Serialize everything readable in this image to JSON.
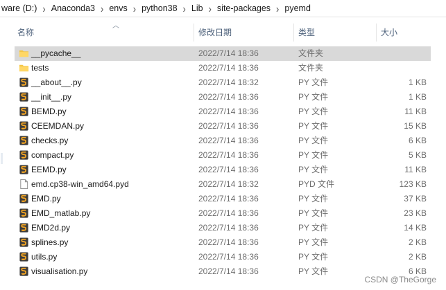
{
  "breadcrumb": [
    "ware (D:)",
    "Anaconda3",
    "envs",
    "python38",
    "Lib",
    "site-packages",
    "pyemd"
  ],
  "columns": {
    "name": "名称",
    "date": "修改日期",
    "type": "类型",
    "size": "大小"
  },
  "files": [
    {
      "name": "__pycache__",
      "date": "2022/7/14 18:36",
      "type": "文件夹",
      "size": "",
      "icon": "folder-icon",
      "selected": true
    },
    {
      "name": "tests",
      "date": "2022/7/14 18:36",
      "type": "文件夹",
      "size": "",
      "icon": "folder-icon"
    },
    {
      "name": "__about__.py",
      "date": "2022/7/14 18:32",
      "type": "PY 文件",
      "size": "1 KB",
      "icon": "python-file-icon"
    },
    {
      "name": "__init__.py",
      "date": "2022/7/14 18:36",
      "type": "PY 文件",
      "size": "1 KB",
      "icon": "python-file-icon"
    },
    {
      "name": "BEMD.py",
      "date": "2022/7/14 18:36",
      "type": "PY 文件",
      "size": "11 KB",
      "icon": "python-file-icon"
    },
    {
      "name": "CEEMDAN.py",
      "date": "2022/7/14 18:36",
      "type": "PY 文件",
      "size": "15 KB",
      "icon": "python-file-icon"
    },
    {
      "name": "checks.py",
      "date": "2022/7/14 18:36",
      "type": "PY 文件",
      "size": "6 KB",
      "icon": "python-file-icon"
    },
    {
      "name": "compact.py",
      "date": "2022/7/14 18:36",
      "type": "PY 文件",
      "size": "5 KB",
      "icon": "python-file-icon"
    },
    {
      "name": "EEMD.py",
      "date": "2022/7/14 18:36",
      "type": "PY 文件",
      "size": "11 KB",
      "icon": "python-file-icon"
    },
    {
      "name": "emd.cp38-win_amd64.pyd",
      "date": "2022/7/14 18:32",
      "type": "PYD 文件",
      "size": "123 KB",
      "icon": "blank-file-icon"
    },
    {
      "name": "EMD.py",
      "date": "2022/7/14 18:36",
      "type": "PY 文件",
      "size": "37 KB",
      "icon": "python-file-icon"
    },
    {
      "name": "EMD_matlab.py",
      "date": "2022/7/14 18:36",
      "type": "PY 文件",
      "size": "23 KB",
      "icon": "python-file-icon"
    },
    {
      "name": "EMD2d.py",
      "date": "2022/7/14 18:36",
      "type": "PY 文件",
      "size": "14 KB",
      "icon": "python-file-icon"
    },
    {
      "name": "splines.py",
      "date": "2022/7/14 18:36",
      "type": "PY 文件",
      "size": "2 KB",
      "icon": "python-file-icon"
    },
    {
      "name": "utils.py",
      "date": "2022/7/14 18:36",
      "type": "PY 文件",
      "size": "2 KB",
      "icon": "python-file-icon"
    },
    {
      "name": "visualisation.py",
      "date": "2022/7/14 18:36",
      "type": "PY 文件",
      "size": "6 KB",
      "icon": "python-file-icon"
    }
  ],
  "watermark": "CSDN @TheGorge",
  "colors": {
    "folder": "#f4c646",
    "python": "#f5a623",
    "selection": "#d9d9d9",
    "header_text": "#4c607a"
  }
}
